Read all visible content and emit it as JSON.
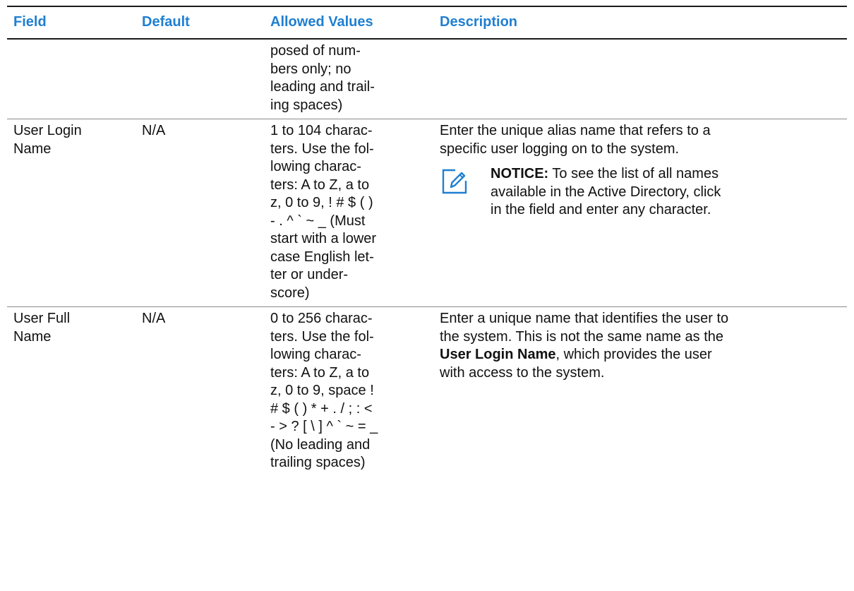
{
  "table": {
    "headers": {
      "field": "Field",
      "default": "Default",
      "allowed": "Allowed Values",
      "description": "Description"
    },
    "rows": [
      {
        "field": "",
        "default": "",
        "allowed": [
          "posed of num-",
          "bers only; no",
          "leading and trail-",
          "ing spaces)"
        ],
        "description": ""
      },
      {
        "field": [
          "User Login",
          "Name"
        ],
        "default": "N/A",
        "allowed": [
          "1 to 104 charac-",
          "ters. Use the fol-",
          "lowing charac-",
          "ters: A to Z, a to",
          "z, 0 to 9, ! # $ ( )",
          "- . ^ ` ~ _ (Must",
          "start with a lower",
          "case English let-",
          "ter or under-",
          "score)"
        ],
        "description": [
          "Enter the unique alias name that refers to a",
          "specific user logging on to the system."
        ],
        "notice": {
          "icon": "note-pencil-icon",
          "label": "NOTICE:",
          "lines_first": " To see the list of all names",
          "line2": "available in the Active Directory, click",
          "line3": "in the field and enter any character."
        }
      },
      {
        "field": [
          "User Full",
          "Name"
        ],
        "default": "N/A",
        "allowed": [
          "0 to 256 charac-",
          "ters. Use the fol-",
          "lowing charac-",
          "ters: A to Z, a to",
          "z, 0 to 9, space !",
          "# $ ( ) * + . / ; : <",
          "- > ? [ \\ ] ^ ` ~ = _",
          "(No leading and",
          "trailing spaces)"
        ],
        "description": {
          "line1": "Enter a unique name that identifies the user to",
          "line2": "the system. This is not the same name as the",
          "bold": "User Login Name",
          "line3_rest": ", which provides the user",
          "line4": "with access to the system."
        }
      }
    ]
  },
  "colors": {
    "header_text": "#1f7fd1",
    "icon": "#1f7fd1"
  }
}
